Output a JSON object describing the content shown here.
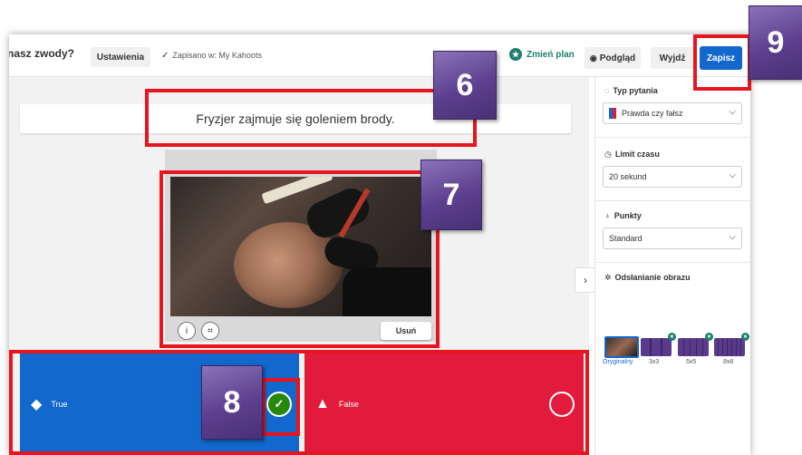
{
  "header": {
    "kahoot_title": "nasz zwody?",
    "settings_label": "Ustawienia",
    "saved_text": "Zapisano w: My Kahoots",
    "change_plan_label": "Zmień plan",
    "preview_label": "Podgląd",
    "exit_label": "Wyjdź",
    "save_label": "Zapisz"
  },
  "question": {
    "text": "Fryzjer zajmuje się goleniem brody."
  },
  "media": {
    "remove_label": "Usuń",
    "info_icon": "info-icon",
    "crop_icon": "crop-icon"
  },
  "answers": [
    {
      "label": "True",
      "shape": "diamond",
      "color": "#1368ce",
      "correct": true
    },
    {
      "label": "False",
      "shape": "triangle",
      "color": "#e21b3c",
      "correct": false
    }
  ],
  "panel": {
    "question_type_title": "Typ pytania",
    "question_type_value": "Prawda czy fałsz",
    "time_limit_title": "Limit czasu",
    "time_limit_value": "20 sekund",
    "points_title": "Punkty",
    "points_value": "Standard",
    "image_reveal_title": "Odsłanianie obrazu",
    "reveal_options": [
      "Oryginalny",
      "3x3",
      "5x5",
      "8x8"
    ]
  },
  "callouts": {
    "six": "6",
    "seven": "7",
    "eight": "8",
    "nine": "9"
  },
  "colors": {
    "accent_blue": "#1368ce",
    "answer_red": "#e21b3c",
    "correct_green": "#26890c",
    "highlight_red": "#e8141e",
    "callout_purple": "#5c3f8f"
  }
}
